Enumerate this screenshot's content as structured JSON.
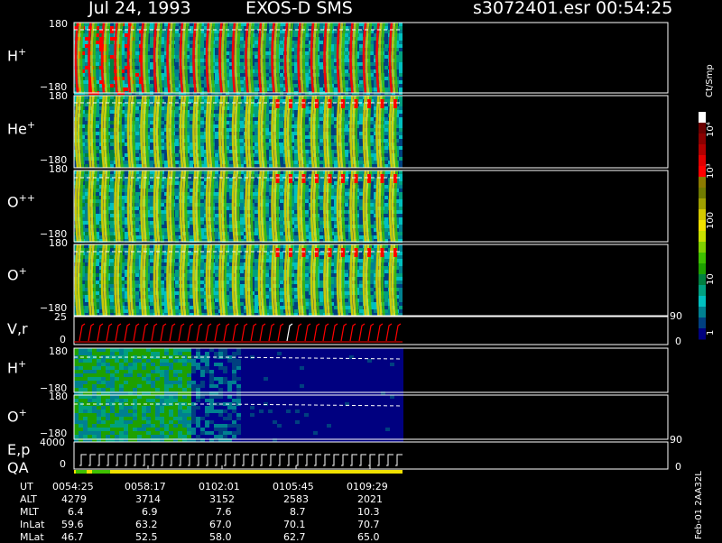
{
  "header": {
    "date": "Jul 24, 1993",
    "instrument": "EXOS-D SMS",
    "file": "s3072401.esr",
    "time": "00:54:25"
  },
  "colors": {
    "background": "#000000",
    "frame": "#ffffff",
    "palette": [
      "#ffffff",
      "#6b0000",
      "#8b0000",
      "#b00000",
      "#e00000",
      "#ff0000",
      "#8b7a00",
      "#6f7a00",
      "#a0a000",
      "#d4c800",
      "#f0e000",
      "#c8e000",
      "#80d000",
      "#3fc000",
      "#1ea000",
      "#008040",
      "#00a080",
      "#00c0c0",
      "#008090",
      "#004080",
      "#000080"
    ]
  },
  "panels": [
    {
      "label_base": "H",
      "label_sup": "+",
      "ymax": "180",
      "ymin": "−180",
      "kind": "spin"
    },
    {
      "label_base": "He",
      "label_sup": "+",
      "ymax": "180",
      "ymin": "−180",
      "kind": "spin"
    },
    {
      "label_base": "O",
      "label_sup": "++",
      "ymax": "180",
      "ymin": "−180",
      "kind": "spin"
    },
    {
      "label_base": "O",
      "label_sup": "+",
      "ymax": "180",
      "ymin": "−180",
      "kind": "spin"
    }
  ],
  "vr_panel": {
    "label": "V,r",
    "ymax": "25",
    "ymin": "0",
    "right_top": "90",
    "right_bottom": "0"
  },
  "lower_panels": [
    {
      "label_base": "H",
      "label_sup": "+",
      "ymax": "180",
      "ymin": "−180"
    },
    {
      "label_base": "O",
      "label_sup": "+",
      "ymax": "180",
      "ymin": "−180"
    }
  ],
  "ep_panel": {
    "label1": "E,p",
    "label2": "QA",
    "ymax": "4000",
    "ymin": "0",
    "right_top": "90",
    "right_bottom": "0"
  },
  "colorbar": {
    "unit": "Ct/Smp",
    "ticks": [
      "10⁴",
      "10³",
      "100",
      "10",
      "1"
    ]
  },
  "footer": {
    "row_labels": [
      "UT",
      "ALT",
      "MLT",
      "InLat",
      "MLat"
    ],
    "columns": [
      {
        "UT": "0054:25",
        "ALT": "4279",
        "MLT": "6.4",
        "InLat": "59.6",
        "MLat": "46.7"
      },
      {
        "UT": "0058:17",
        "ALT": "3714",
        "MLT": "6.9",
        "InLat": "63.2",
        "MLat": "52.5"
      },
      {
        "UT": "0102:01",
        "ALT": "3152",
        "MLT": "7.6",
        "InLat": "67.0",
        "MLat": "58.0"
      },
      {
        "UT": "0105:45",
        "ALT": "2583",
        "MLT": "8.7",
        "InLat": "70.1",
        "MLat": "62.7"
      },
      {
        "UT": "0109:29",
        "ALT": "2021",
        "MLT": "10.3",
        "InLat": "70.7",
        "MLat": "65.0"
      }
    ],
    "side_note": "Feb-01 2AA32L"
  },
  "chart_data": {
    "type": "heatmap",
    "title": "Jul 24, 1993 EXOS-D SMS",
    "x_axis": {
      "label": "UT",
      "ticks": [
        "0054:25",
        "0058:17",
        "0102:01",
        "0105:45",
        "0109:29"
      ]
    },
    "pitch_angle_range": [
      -180,
      180
    ],
    "species_panels": [
      "H+",
      "He+",
      "O++",
      "O+"
    ],
    "colorbar_range": [
      1,
      10000
    ],
    "colorbar_scale": "log",
    "vr_range": [
      0,
      25
    ],
    "ep_range": [
      0,
      4000
    ]
  }
}
